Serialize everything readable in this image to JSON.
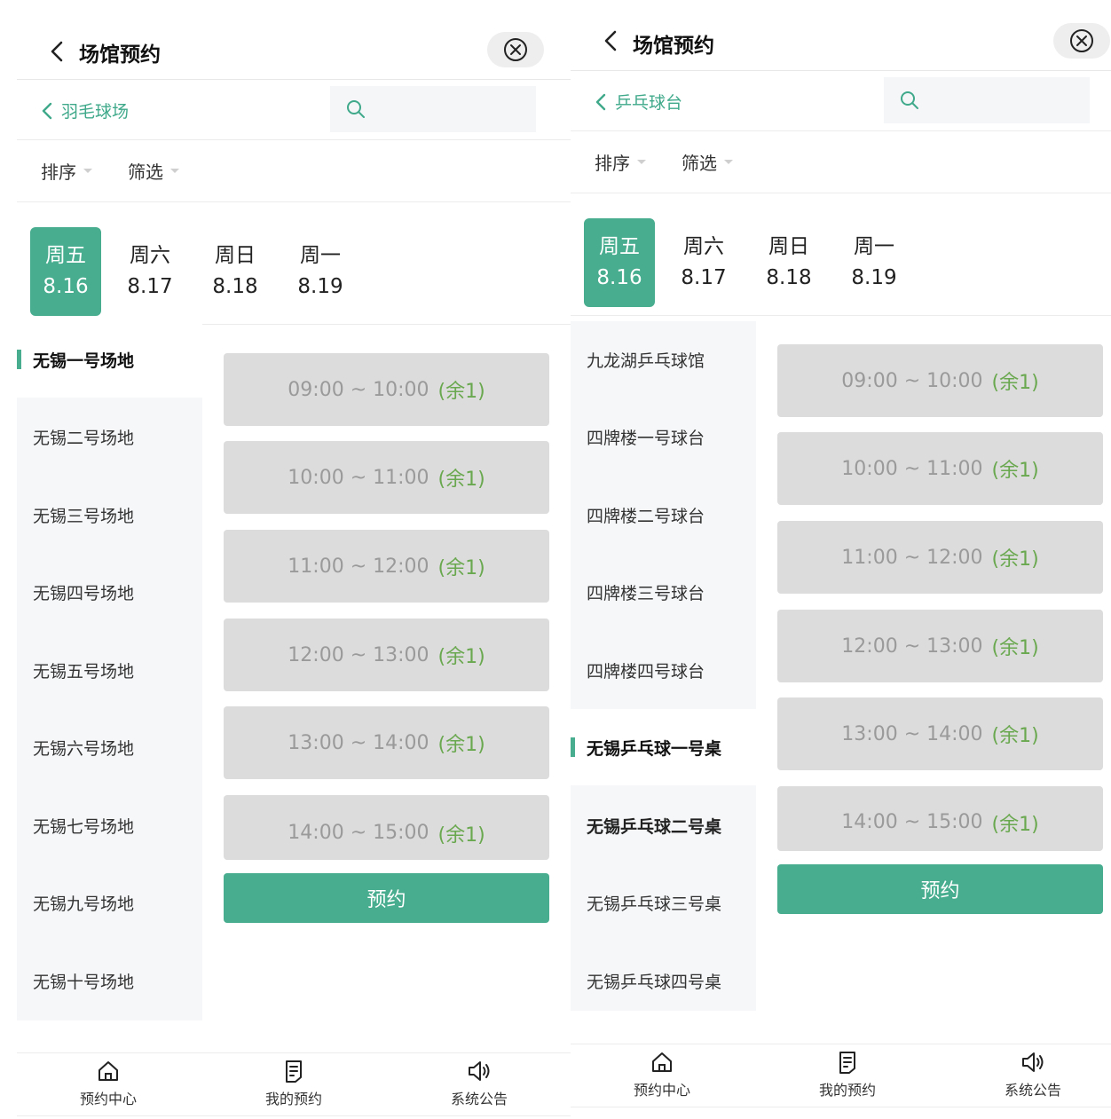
{
  "colors": {
    "accent": "#47ad8e",
    "remain": "#6aa84f",
    "slot_bg": "#dcdcdc"
  },
  "screens": [
    {
      "title": "场馆预约",
      "category": "羽毛球场",
      "filters": {
        "sort": "排序",
        "filter": "筛选"
      },
      "dates": [
        {
          "weekday": "周五",
          "date": "8.16"
        },
        {
          "weekday": "周六",
          "date": "8.17"
        },
        {
          "weekday": "周日",
          "date": "8.18"
        },
        {
          "weekday": "周一",
          "date": "8.19"
        }
      ],
      "venues": [
        "无锡一号场地",
        "无锡二号场地",
        "无锡三号场地",
        "无锡四号场地",
        "无锡五号场地",
        "无锡六号场地",
        "无锡七号场地",
        "无锡九号场地",
        "无锡十号场地"
      ],
      "selected_venue": "无锡一号场地",
      "slots": [
        {
          "time": "09:00 ~ 10:00",
          "remain": "(余1)"
        },
        {
          "time": "10:00 ~ 11:00",
          "remain": "(余1)"
        },
        {
          "time": "11:00 ~ 12:00",
          "remain": "(余1)"
        },
        {
          "time": "12:00 ~ 13:00",
          "remain": "(余1)"
        },
        {
          "time": "13:00 ~ 14:00",
          "remain": "(余1)"
        },
        {
          "time": "14:00 ~ 15:00",
          "remain": "(余1)"
        }
      ],
      "book_label": "预约",
      "tabs": [
        {
          "label": "预约中心",
          "icon": "home-icon"
        },
        {
          "label": "我的预约",
          "icon": "document-icon"
        },
        {
          "label": "系统公告",
          "icon": "speaker-icon"
        }
      ]
    },
    {
      "title": "场馆预约",
      "category": "乒乓球台",
      "filters": {
        "sort": "排序",
        "filter": "筛选"
      },
      "dates": [
        {
          "weekday": "周五",
          "date": "8.16"
        },
        {
          "weekday": "周六",
          "date": "8.17"
        },
        {
          "weekday": "周日",
          "date": "8.18"
        },
        {
          "weekday": "周一",
          "date": "8.19"
        }
      ],
      "venues": [
        "九龙湖乒乓球馆",
        "四牌楼一号球台",
        "四牌楼二号球台",
        "四牌楼三号球台",
        "四牌楼四号球台",
        "无锡乒乓球一号桌",
        "无锡乒乓球二号桌",
        "无锡乒乓球三号桌",
        "无锡乒乓球四号桌"
      ],
      "selected_venue": "无锡乒乓球一号桌",
      "slots": [
        {
          "time": "09:00 ~ 10:00",
          "remain": "(余1)"
        },
        {
          "time": "10:00 ~ 11:00",
          "remain": "(余1)"
        },
        {
          "time": "11:00 ~ 12:00",
          "remain": "(余1)"
        },
        {
          "time": "12:00 ~ 13:00",
          "remain": "(余1)"
        },
        {
          "time": "13:00 ~ 14:00",
          "remain": "(余1)"
        },
        {
          "time": "14:00 ~ 15:00",
          "remain": "(余1)"
        }
      ],
      "book_label": "预约",
      "tabs": [
        {
          "label": "预约中心",
          "icon": "home-icon"
        },
        {
          "label": "我的预约",
          "icon": "document-icon"
        },
        {
          "label": "系统公告",
          "icon": "speaker-icon"
        }
      ]
    }
  ]
}
